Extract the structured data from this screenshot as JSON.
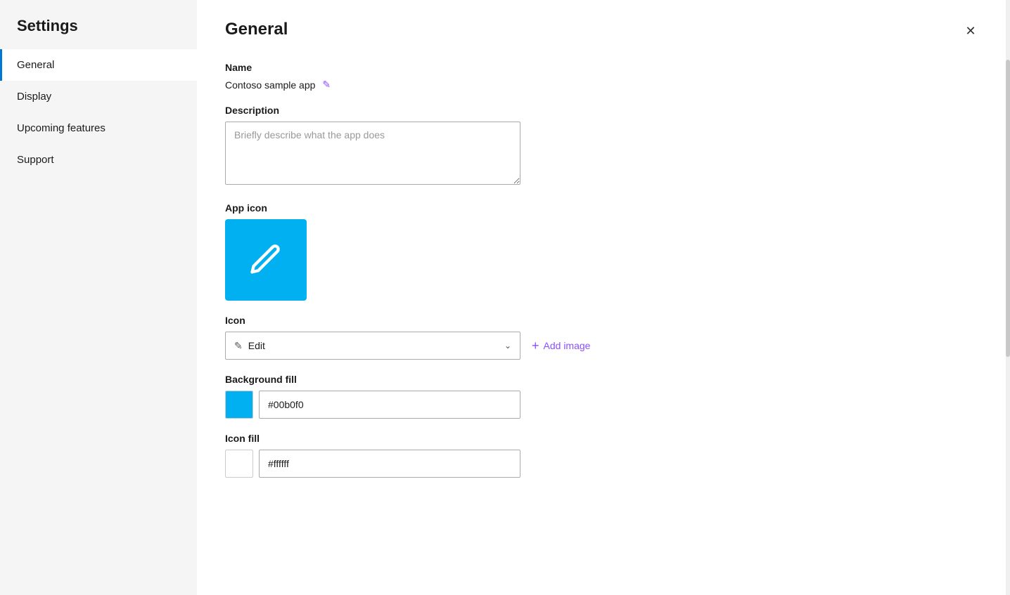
{
  "sidebar": {
    "title": "Settings",
    "items": [
      {
        "id": "general",
        "label": "General",
        "active": true
      },
      {
        "id": "display",
        "label": "Display",
        "active": false
      },
      {
        "id": "upcoming-features",
        "label": "Upcoming features",
        "active": false
      },
      {
        "id": "support",
        "label": "Support",
        "active": false
      }
    ]
  },
  "main": {
    "title": "General",
    "close_label": "✕",
    "name_section": {
      "label": "Name",
      "value": "Contoso sample app",
      "edit_icon": "✏"
    },
    "description_section": {
      "label": "Description",
      "placeholder": "Briefly describe what the app does"
    },
    "app_icon_section": {
      "label": "App icon",
      "icon_color": "#00b0f0"
    },
    "icon_section": {
      "label": "Icon",
      "select_value": "Edit",
      "add_image_label": "Add image"
    },
    "background_fill_section": {
      "label": "Background fill",
      "color": "#00b0f0",
      "value": "#00b0f0"
    },
    "icon_fill_section": {
      "label": "Icon fill",
      "color": "#ffffff",
      "value": "#ffffff"
    }
  }
}
